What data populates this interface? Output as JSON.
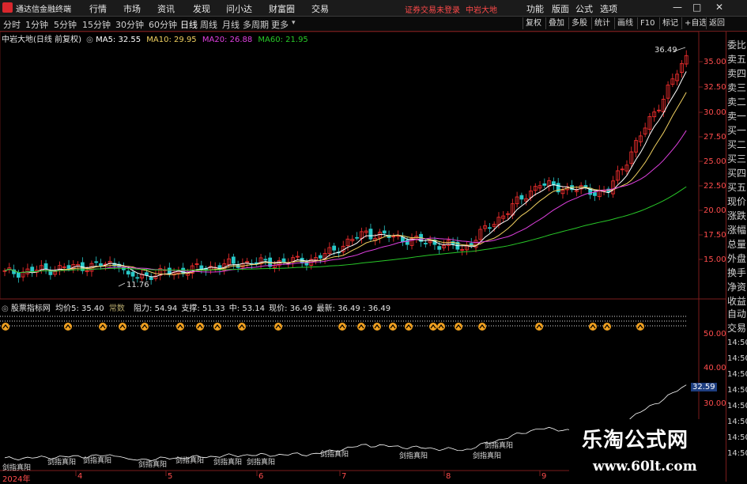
{
  "app": {
    "title": "通达信金融终端"
  },
  "menu": [
    "行情",
    "市场",
    "资讯",
    "发现",
    "问小达",
    "财富圈",
    "交易"
  ],
  "status_warning": "证券交易未登录",
  "stock_title_top": "中岩大地",
  "right_menu": [
    "功能",
    "版面",
    "公式",
    "选项"
  ],
  "window_controls": [
    "—",
    "□",
    "✕"
  ],
  "periods": [
    "分时",
    "1分钟",
    "5分钟",
    "15分钟",
    "30分钟",
    "60分钟",
    "日线",
    "周线",
    "月线",
    "多周期",
    "更多"
  ],
  "active_period": "日线",
  "toolbar_buttons": [
    "复权",
    "叠加",
    "多股",
    "统计",
    "画线",
    "F10",
    "标记",
    "+自选",
    "返回"
  ],
  "chart_header": {
    "title": "中岩大地(日线 前复权)",
    "ma5": "MA5: 32.55",
    "ma10": "MA10: 29.95",
    "ma20": "MA20: 26.88",
    "ma60": "MA60: 21.95"
  },
  "price_axis": [
    "35.00",
    "32.50",
    "30.00",
    "27.50",
    "25.00",
    "22.50",
    "20.00",
    "17.50",
    "15.00"
  ],
  "annotations": {
    "high": "36.49",
    "low": "11.76"
  },
  "sub_header": {
    "name": "股票指标网",
    "avg": "均价5: 35.40",
    "tag": "常数",
    "resist": "阻力: 54.94",
    "support": "支撑: 51.33",
    "mid": "中: 53.14",
    "now": "现价: 36.49",
    "latest": "最新: 36.49",
    "last": ": 36.49"
  },
  "sub_axis": [
    "50.00",
    "40.00",
    "30.00"
  ],
  "sub_current": "32.59",
  "date_axis": [
    "2024年",
    "4",
    "5",
    "6",
    "7",
    "8",
    "9"
  ],
  "right_panel": [
    "委比",
    "卖五",
    "卖四",
    "卖三",
    "卖二",
    "卖一",
    "买一",
    "买二",
    "买三",
    "买四",
    "买五",
    "现价",
    "涨跌",
    "涨幅",
    "总量",
    "外盘",
    "换手",
    "净资",
    "收益",
    "自动",
    "交易",
    "14:50",
    "14:50",
    "14:50",
    "14:50",
    "14:50",
    "14:50",
    "14:50",
    "14:50"
  ],
  "bottom_labels": [
    "剑指真阳",
    "剑指真阳",
    "剑指真阳",
    "剑指真阳",
    "剑指真阳",
    "剑指真阳",
    "剑指真阳",
    "剑指真阳",
    "剑指真阳",
    "剑指真阳",
    "剑指真阳",
    "剑指真阳"
  ],
  "watermark": {
    "cn": "乐淘公式网",
    "url": "www.60lt.com"
  },
  "colors": {
    "up": "#ff3030",
    "down": "#28c8c8",
    "ma5": "#ffffff",
    "ma10": "#f0d060",
    "ma20": "#e040e0",
    "ma60": "#28c828",
    "axis": "#ff4c4c"
  }
}
